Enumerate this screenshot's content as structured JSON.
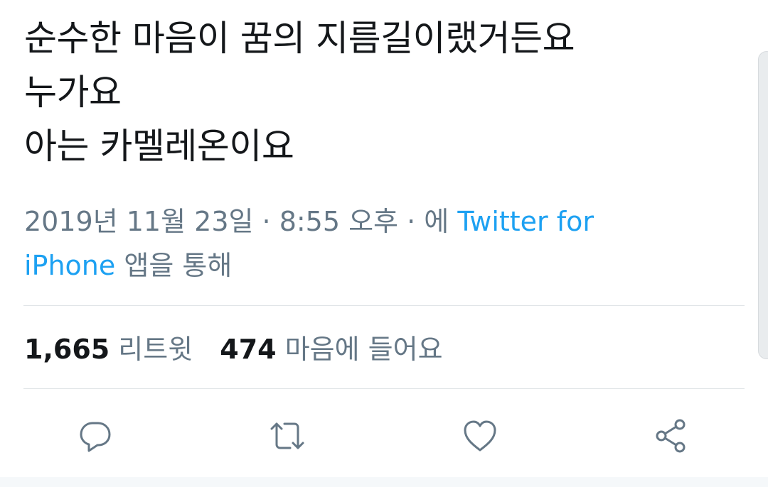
{
  "tweet": {
    "lines": [
      "순수한 마음이 꿈의 지름길이랬거든요",
      "누가요",
      "아는 카멜레온이요"
    ]
  },
  "meta": {
    "datetime": "2019년 11월 23일 · 8:55 오후 · 에 ",
    "source_link_part1": "Twitter for",
    "source_link_part2": "iPhone",
    "via_suffix": " 앱을 통해"
  },
  "stats": {
    "retweets_count": "1,665",
    "retweets_label": "리트윗",
    "likes_count": "474",
    "likes_label": "마음에 들어요"
  },
  "actions": {
    "reply_icon": "reply-icon",
    "retweet_icon": "retweet-icon",
    "like_icon": "heart-icon",
    "share_icon": "share-icon"
  },
  "colors": {
    "text": "#14171a",
    "secondary": "#657786",
    "link": "#1da1f2",
    "divider": "#dfe3e6"
  }
}
